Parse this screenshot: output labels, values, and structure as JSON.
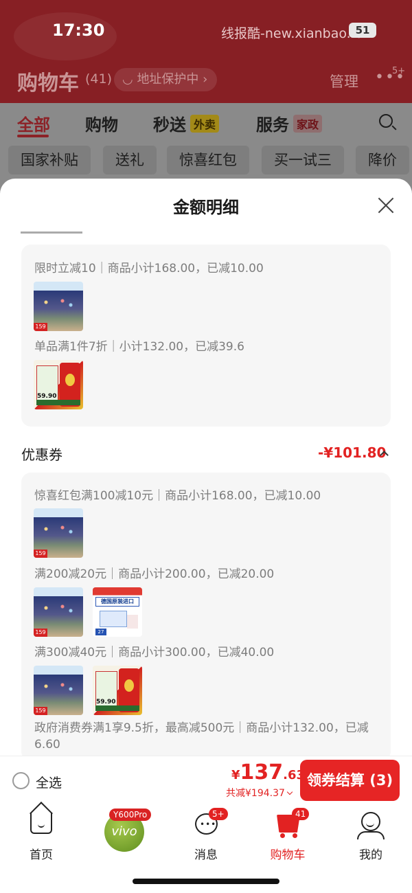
{
  "status_bar": {
    "time": "17:30",
    "right_text": "线报酷-new.xianbao.fun",
    "battery": "51"
  },
  "header": {
    "title": "购物车",
    "count": "(41)",
    "address_label": "地址保护中",
    "manage_label": "管理",
    "more_badge": "5+"
  },
  "tabs": [
    {
      "label": "全部",
      "tag": ""
    },
    {
      "label": "购物",
      "tag": ""
    },
    {
      "label": "秒送",
      "tag": "外卖"
    },
    {
      "label": "服务",
      "tag": "家政"
    }
  ],
  "filter_chips": [
    "国家补贴",
    "送礼",
    "惊喜红包",
    "买一试三",
    "降价"
  ],
  "sheet": {
    "title": "金额明细",
    "promo_panel": {
      "rule_1": "限时立减10｜商品小计168.00，已减10.00",
      "rule_2": "单品满1件7折｜小计132.00，已减39.6"
    },
    "coupon_section": {
      "label": "优惠券",
      "amount": "-¥101.80",
      "rules": [
        "惊喜红包满100减10元｜商品小计168.00，已减10.00",
        "满200减20元｜商品小计200.00，已减20.00",
        "满300减40元｜商品小计300.00，已减40.00",
        "政府消费券满1享9.5折，最高减500元｜商品小计132.00，已减6.60"
      ]
    }
  },
  "product_thumbs": {
    "puzzle_price": "159",
    "rice_price": "59.90",
    "milk_banner": "德国原装进口",
    "milk_price": "27"
  },
  "checkout": {
    "select_all": "全选",
    "currency": "¥",
    "total_int": "137",
    "total_dec": ".63",
    "saving_text": "共减¥194.37",
    "button_label": "领券结算 (3)"
  },
  "nav": {
    "home": "首页",
    "vivo_tag": "Y600Pro",
    "vivo_label": "vivo",
    "messages": "消息",
    "messages_badge": "5+",
    "cart": "购物车",
    "cart_badge": "41",
    "me": "我的"
  },
  "colors": {
    "accent_red": "#e22222",
    "header_bg_dimmed": "#871f24",
    "panel_bg": "#f6f6f6"
  }
}
